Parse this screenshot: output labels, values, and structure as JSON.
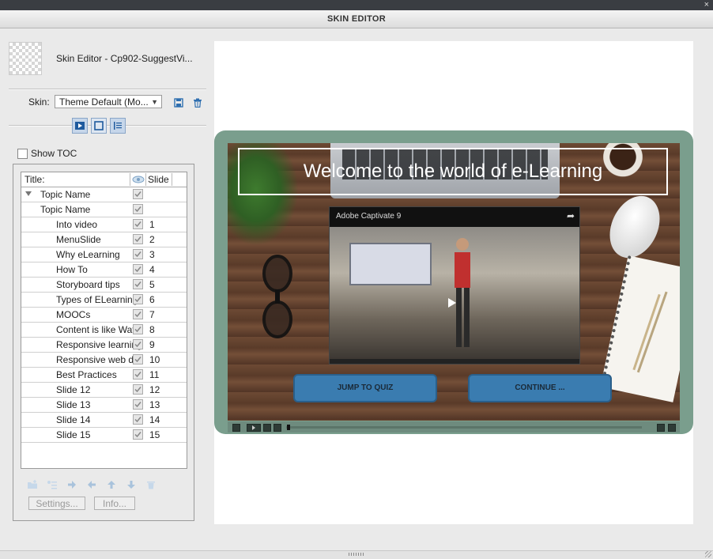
{
  "window": {
    "title": "SKIN EDITOR",
    "close_glyph": "×"
  },
  "skin": {
    "editor_title": "Skin Editor - Cp902-SuggestVi...",
    "label": "Skin:",
    "selected": "Theme Default (Mo..."
  },
  "toc": {
    "show_toc_label": "Show TOC",
    "show_toc_checked": false,
    "col_title": "Title:",
    "col_slide": "Slide",
    "rows": [
      {
        "name": "Topic Name",
        "slide": "",
        "level": 0,
        "expander": true
      },
      {
        "name": "Topic Name",
        "slide": "",
        "level": 2,
        "expander": false
      },
      {
        "name": "Into video",
        "slide": "1",
        "level": 1,
        "expander": false
      },
      {
        "name": "MenuSlide",
        "slide": "2",
        "level": 1,
        "expander": false
      },
      {
        "name": "Why eLearning",
        "slide": "3",
        "level": 1,
        "expander": false
      },
      {
        "name": "How To",
        "slide": "4",
        "level": 1,
        "expander": false
      },
      {
        "name": "Storyboard tips",
        "slide": "5",
        "level": 1,
        "expander": false
      },
      {
        "name": "Types of ELearning",
        "slide": "6",
        "level": 1,
        "expander": false
      },
      {
        "name": "MOOCs",
        "slide": "7",
        "level": 1,
        "expander": false
      },
      {
        "name": "Content is like Water",
        "slide": "8",
        "level": 1,
        "expander": false
      },
      {
        "name": "Responsive learning",
        "slide": "9",
        "level": 1,
        "expander": false
      },
      {
        "name": "Responsive web d...",
        "slide": "10",
        "level": 1,
        "expander": false
      },
      {
        "name": "Best Practices",
        "slide": "11",
        "level": 1,
        "expander": false
      },
      {
        "name": "Slide 12",
        "slide": "12",
        "level": 1,
        "expander": false
      },
      {
        "name": "Slide 13",
        "slide": "13",
        "level": 1,
        "expander": false
      },
      {
        "name": "Slide 14",
        "slide": "14",
        "level": 1,
        "expander": false
      },
      {
        "name": "Slide 15",
        "slide": "15",
        "level": 1,
        "expander": false
      }
    ],
    "settings_button": "Settings...",
    "info_button": "Info...",
    "toolbar_icons": [
      "new-folder-icon",
      "indent-icon",
      "arrow-right-icon",
      "arrow-left-icon",
      "arrow-up-icon",
      "arrow-down-icon",
      "trash-icon"
    ]
  },
  "preview": {
    "headline": "Welcome to the world of e-Learning",
    "video_title": "Adobe Captivate 9",
    "jump_button": "JUMP TO QUIZ",
    "continue_button": "CONTINUE ..."
  },
  "colors": {
    "frame": "#7a9e8d",
    "accent": "#3a7cb0",
    "tab_on": "#c6d6ea"
  }
}
